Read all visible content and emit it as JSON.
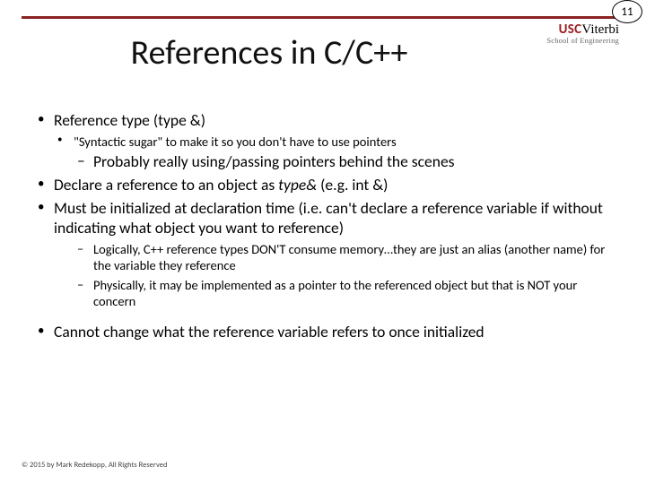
{
  "page_number": "11",
  "logo": {
    "usc": "USC",
    "viterbi": "Viterbi",
    "sub": "School of Engineering"
  },
  "title": "References in C/C++",
  "bullets": {
    "l1a": "Reference type (type &)",
    "l2a": "\"Syntactic sugar\" to make it so you don't have to use pointers",
    "l3a": "Probably really using/passing pointers behind the scenes",
    "l1b_pre": "Declare a reference to an object as ",
    "l1b_em": "type&",
    "l1b_post": " (e.g. int &)",
    "l1c": "Must be initialized at declaration time (i.e. can't declare a reference variable if without indicating what object you want to reference)",
    "l3b": "Logically, C++ reference types DON'T consume memory…they are just an alias (another name) for the variable they reference",
    "l3c": "Physically, it may be implemented as a pointer to the referenced object but that is NOT your concern",
    "l1d": "Cannot change what the reference variable refers to once initialized"
  },
  "footer": "© 2015 by Mark Redekopp, All Rights Reserved"
}
